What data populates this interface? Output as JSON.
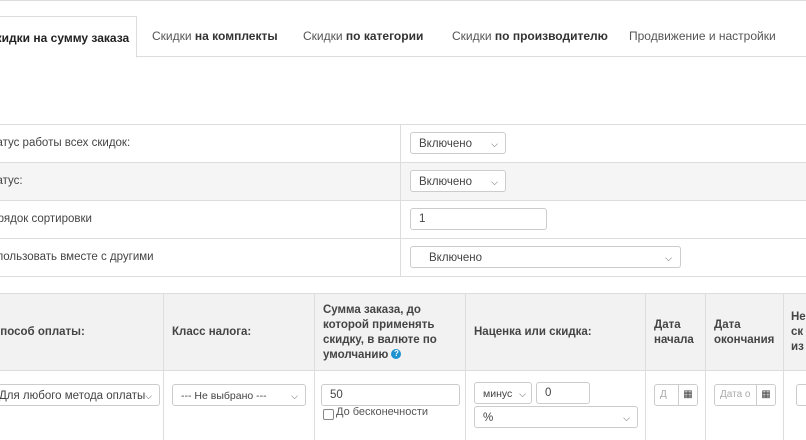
{
  "tabs": [
    {
      "normal": "",
      "bold": "Скидки на сумму заказа"
    },
    {
      "normal": "Скидки ",
      "bold": "на комплекты"
    },
    {
      "normal": "Скидки ",
      "bold": "по категории"
    },
    {
      "normal": "Скидки ",
      "bold": "по производителю"
    },
    {
      "normal": "Продвижение и настройки",
      "bold": ""
    }
  ],
  "settings": {
    "all_status": {
      "label": "Статус работы всех скидок:",
      "value": "Включено"
    },
    "status": {
      "label": "Статус:",
      "value": "Включено"
    },
    "sort_order": {
      "label": "Порядок сортировки",
      "value": "1"
    },
    "use_with_others": {
      "label": "Использовать вместе с другими",
      "value": "Включено"
    }
  },
  "table": {
    "headers": {
      "payment": "Способ оплаты:",
      "tax": "Класс налога:",
      "sum": "Сумма заказа, до которой применять скидку, в валюте по умолчанию",
      "markup": "Наценка или скидка:",
      "start": "Дата начала",
      "end": "Дата окончания",
      "extra": "Не ск из"
    },
    "row": {
      "payment": "Для любого метода оплаты",
      "tax": "--- Не выбрано ---",
      "sum": "50",
      "infinity_label": "До бесконечности",
      "sign": "минус",
      "amount": "0",
      "type": "%",
      "start_placeholder": "Д",
      "end_placeholder": "Дата о"
    }
  },
  "icons": {
    "chevron": "chevron-down-icon",
    "calendar": "calendar-icon",
    "info": "info-icon"
  },
  "colors": {
    "info": "#1e91cf",
    "header_bg": "#f2f2f2",
    "border": "#dddddd"
  }
}
